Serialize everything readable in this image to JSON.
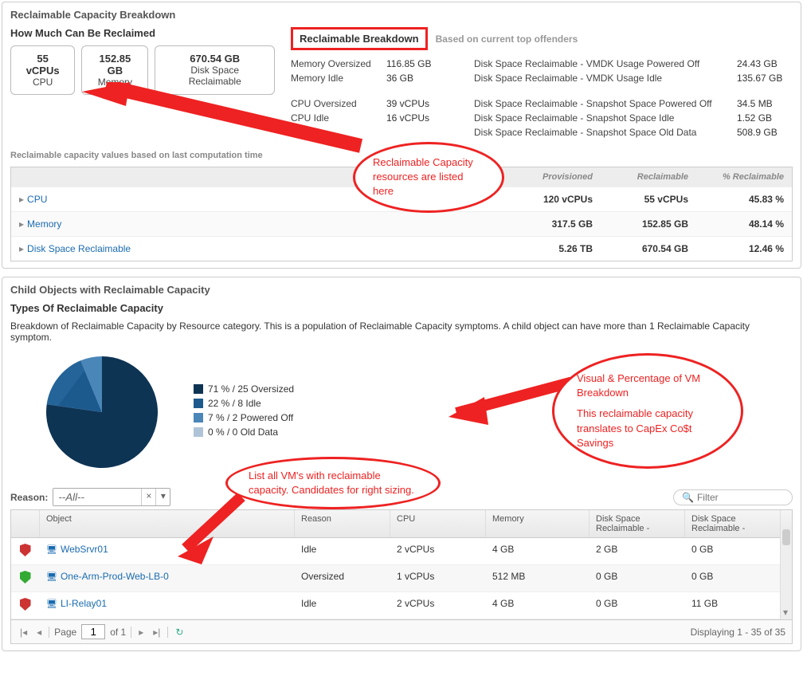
{
  "panel1": {
    "title": "Reclaimable Capacity Breakdown",
    "subtitle": "How Much Can Be Reclaimed",
    "boxes": {
      "cpu_val": "55 vCPUs",
      "cpu_lbl": "CPU",
      "mem_val": "152.85 GB",
      "mem_lbl": "Memory",
      "disk_val": "670.54 GB",
      "disk_lbl": "Disk Space Reclaimable"
    },
    "breakdown_title": "Reclaimable Breakdown",
    "based_on": "Based on current top offenders",
    "colA": [
      {
        "l": "Memory Oversized",
        "v": "116.85 GB"
      },
      {
        "l": "Memory Idle",
        "v": "36 GB"
      },
      {
        "l": "",
        "v": ""
      },
      {
        "l": "CPU Oversized",
        "v": "39 vCPUs"
      },
      {
        "l": "CPU Idle",
        "v": "16 vCPUs"
      }
    ],
    "colB": [
      {
        "l": "Disk Space Reclaimable - VMDK Usage Powered Off",
        "v": "24.43 GB"
      },
      {
        "l": "Disk Space Reclaimable - VMDK Usage Idle",
        "v": "135.67 GB"
      },
      {
        "l": "",
        "v": ""
      },
      {
        "l": "Disk Space Reclaimable - Snapshot Space Powered Off",
        "v": "34.5 MB"
      },
      {
        "l": "Disk Space Reclaimable - Snapshot Space Idle",
        "v": "1.52 GB"
      },
      {
        "l": "Disk Space Reclaimable - Snapshot Space Old Data",
        "v": "508.9 GB"
      }
    ],
    "note": "Reclaimable capacity values based on last computation time",
    "table": {
      "headers": {
        "prov": "Provisioned",
        "recl": "Reclaimable",
        "pct": "% Reclaimable"
      },
      "rows": [
        {
          "obj": "CPU",
          "prov": "120 vCPUs",
          "recl": "55 vCPUs",
          "pct": "45.83 %"
        },
        {
          "obj": "Memory",
          "prov": "317.5 GB",
          "recl": "152.85 GB",
          "pct": "48.14 %"
        },
        {
          "obj": "Disk Space Reclaimable",
          "prov": "5.26 TB",
          "recl": "670.54 GB",
          "pct": "12.46 %"
        }
      ]
    }
  },
  "panel2": {
    "title": "Child Objects with Reclaimable Capacity",
    "subtitle": "Types Of Reclaimable Capacity",
    "desc": "Breakdown of Reclaimable Capacity by Resource category. This is a population of Reclaimable Capacity symptoms. A child object can have more than 1 Reclaimable Capacity symptom.",
    "legend": [
      {
        "color": "#0e3454",
        "label": "71 % / 25 Oversized"
      },
      {
        "color": "#1c5a8e",
        "label": "22 % / 8 Idle"
      },
      {
        "color": "#4a86b8",
        "label": "7 % / 2 Powered Off"
      },
      {
        "color": "#b0c4d8",
        "label": "0 % / 0 Old Data"
      }
    ],
    "reason_label": "Reason:",
    "reason_value": "--All--",
    "filter_placeholder": "Filter",
    "grid": {
      "headers": {
        "obj": "Object",
        "reason": "Reason",
        "cpu": "CPU",
        "mem": "Memory",
        "d1": "Disk Space Reclaimable -",
        "d2": "Disk Space Reclaimable -"
      },
      "rows": [
        {
          "status": "red",
          "obj": "WebSrvr01",
          "reason": "Idle",
          "cpu": "2 vCPUs",
          "mem": "4 GB",
          "d1": "2 GB",
          "d2": "0 GB"
        },
        {
          "status": "green",
          "obj": "One-Arm-Prod-Web-LB-0",
          "reason": "Oversized",
          "cpu": "1 vCPUs",
          "mem": "512 MB",
          "d1": "0 GB",
          "d2": "0 GB"
        },
        {
          "status": "red",
          "obj": "LI-Relay01",
          "reason": "Idle",
          "cpu": "2 vCPUs",
          "mem": "4 GB",
          "d1": "0 GB",
          "d2": "11 GB"
        }
      ]
    },
    "pager": {
      "page_label": "Page",
      "page": "1",
      "of": "of 1",
      "display": "Displaying 1 - 35 of 35"
    }
  },
  "annotations": {
    "a1": "Reclaimable Capacity resources are listed here",
    "a2_line1": "Visual & Percentage of VM Breakdown",
    "a2_line2": "This reclaimable capacity translates to CapEx Co$t Savings",
    "a3": "List all VM's with reclaimable capacity. Candidates for right sizing."
  },
  "chart_data": {
    "type": "pie",
    "title": "Types Of Reclaimable Capacity",
    "series": [
      {
        "name": "Oversized",
        "value": 25,
        "pct": 71,
        "color": "#0e3454"
      },
      {
        "name": "Idle",
        "value": 8,
        "pct": 22,
        "color": "#1c5a8e"
      },
      {
        "name": "Powered Off",
        "value": 2,
        "pct": 7,
        "color": "#4a86b8"
      },
      {
        "name": "Old Data",
        "value": 0,
        "pct": 0,
        "color": "#b0c4d8"
      }
    ]
  }
}
